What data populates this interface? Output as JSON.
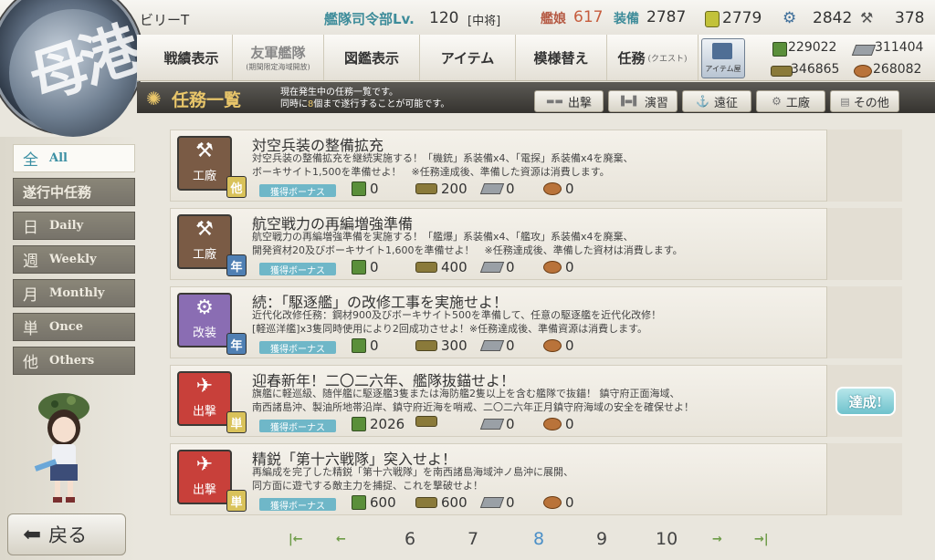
{
  "player": {
    "name": "ビリーT"
  },
  "hq": {
    "label": "艦隊司令部Lv.",
    "level": "120",
    "rank": "[中将]"
  },
  "counts": {
    "ship_label": "艦娘",
    "ship_value": "617",
    "equip_label": "装備",
    "equip_value": "2787"
  },
  "top_resources": [
    {
      "icon": "bucket-icon",
      "value": "2779"
    },
    {
      "icon": "dev-material-icon",
      "value": "2842"
    },
    {
      "icon": "hammer-icon",
      "value": "378"
    }
  ],
  "nav": {
    "items": [
      {
        "label": "戦績表示",
        "sub": ""
      },
      {
        "label": "友軍艦隊",
        "sub": "(期間限定海域開放)"
      },
      {
        "label": "図鑑表示",
        "sub": ""
      },
      {
        "label": "アイテム",
        "sub": ""
      },
      {
        "label": "模様替え",
        "sub": ""
      },
      {
        "label": "任務",
        "sub": "(クエスト)"
      }
    ],
    "shop_label": "アイテム屋"
  },
  "resources": {
    "fuel": "229022",
    "ammo": "311404",
    "steel": "346865",
    "bauxite": "268082"
  },
  "header": {
    "title": "任務一覧",
    "desc_line1": "現在発生中の任務一覧です。",
    "desc_line2_pre": "同時に",
    "desc_line2_num": "8",
    "desc_line2_post": "個まで遂行することが可能です。"
  },
  "category_tabs": [
    "出撃",
    "演習",
    "遠征",
    "工廠",
    "その他"
  ],
  "sidebar": [
    {
      "big": "全",
      "small": "All",
      "active": true
    },
    {
      "big": "",
      "small": "遂行中任務",
      "active": false
    },
    {
      "big": "日",
      "small": "Daily",
      "active": false
    },
    {
      "big": "週",
      "small": "Weekly",
      "active": false
    },
    {
      "big": "月",
      "small": "Monthly",
      "active": false
    },
    {
      "big": "単",
      "small": "Once",
      "active": false
    },
    {
      "big": "他",
      "small": "Others",
      "active": false
    }
  ],
  "bonus_label": "獲得ボーナス",
  "quests": [
    {
      "category": "工廠",
      "category_color": "#7a5b45",
      "badge": "他",
      "badge_color": "#d9c25a",
      "title": "対空兵装の整備拡充",
      "desc1": "対空兵装の整備拡充を継続実施する！「機銃」系装備x4、「電探」系装備x4を廃棄、",
      "desc2": "ボーキサイト1,500を準備せよ！　※任務達成後、準備した資源は消費します。",
      "fuel": "0",
      "ammo": "200",
      "steel": "0",
      "bauxite": "0",
      "status": ""
    },
    {
      "category": "工廠",
      "category_color": "#7a5b45",
      "badge": "年",
      "badge_color": "#4f7fb3",
      "title": "航空戦力の再編増強準備",
      "desc1": "航空戦力の再編増強準備を実施する！「艦爆」系装備x4、「艦攻」系装備x4を廃棄、",
      "desc2": "開発資材20及びボーキサイト1,600を準備せよ！　※任務達成後、準備した資材は消費します。",
      "fuel": "0",
      "ammo": "400",
      "steel": "0",
      "bauxite": "0",
      "status": ""
    },
    {
      "category": "改装",
      "category_color": "#8a6db3",
      "badge": "年",
      "badge_color": "#4f7fb3",
      "title": "続：「駆逐艦」の改修工事を実施せよ！",
      "desc1": "近代化改修任務：鋼材900及びボーキサイト500を準備して、任意の駆逐艦を近代化改修！",
      "desc2": "[軽巡洋艦]x3隻同時使用により2回成功させよ！※任務達成後、準備資源は消費します。",
      "fuel": "0",
      "ammo": "300",
      "steel": "0",
      "bauxite": "0",
      "status": ""
    },
    {
      "category": "出撃",
      "category_color": "#c8403a",
      "badge": "単",
      "badge_color": "#d9c25a",
      "title": "迎春新年！二〇二六年、艦隊抜錨せよ！",
      "desc1": "旗艦に軽巡級、随伴艦に駆逐艦3隻または海防艦2隻以上を含む艦隊で抜錨！ 鎮守府正面海域、",
      "desc2": "南西諸島沖、製油所地帯沿岸、鎮守府近海を哨戒、二〇二六年正月鎮守府海域の安全を確保せよ！",
      "fuel": "2026",
      "ammo": "",
      "steel": "0",
      "bauxite": "0",
      "status": "達成!"
    },
    {
      "category": "出撃",
      "category_color": "#c8403a",
      "badge": "単",
      "badge_color": "#d9c25a",
      "title": "精鋭「第十六戦隊」突入せよ！",
      "desc1": "再編成を完了した精鋭「第十六戦隊」を南西諸島海域沖ノ島沖に展開、",
      "desc2": "同方面に遊弋する敵主力を捕捉、これを撃破せよ！",
      "fuel": "600",
      "ammo": "600",
      "steel": "0",
      "bauxite": "0",
      "status": ""
    }
  ],
  "pager": {
    "pages": [
      "6",
      "7",
      "8",
      "9",
      "10"
    ],
    "current": "8"
  },
  "back_label": "戻る",
  "colors": {
    "accent": "#3b8fa3",
    "header_gold": "#e9c66a",
    "ship_red": "#c65d3e"
  }
}
